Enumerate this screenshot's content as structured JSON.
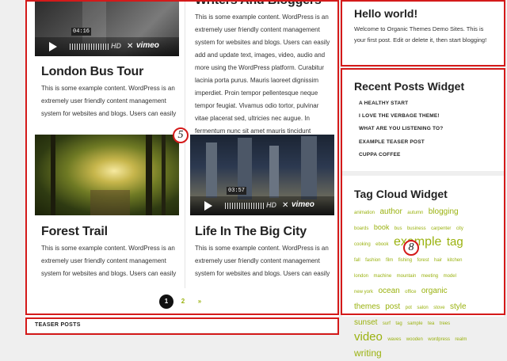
{
  "posts": [
    {
      "title": "London Bus Tour",
      "excerpt": "This is some example content. WordPress is an extremely user friendly content management system for websites and blogs. Users can easily",
      "video": {
        "time": "04:16",
        "hd": "HD",
        "brand": "vimeo"
      }
    },
    {
      "title": "Writers And Bloggers",
      "excerpt": "This is some example content. WordPress is an extremely user friendly content management system for websites and blogs. Users can easily add and update text, images, video, audio and more using the WordPress platform. Curabitur lacinia porta purus. Mauris laoreet dignissim imperdiet. Proin tempor pellentesque neque tempor feugiat. Vivamus odio tortor, pulvinar vitae placerat sed, ultricies nec augue. In fermentum nunc sit amet mauris tincidunt laoreet. Nulla"
    },
    {
      "title": "Forest Trail",
      "excerpt": "This is some example content. WordPress is an extremely user friendly content management system for websites and blogs. Users can easily"
    },
    {
      "title": "Life In The Big City",
      "excerpt": "This is some example content. WordPress is an extremely user friendly content management system for websites and blogs. Users can easily",
      "video": {
        "time": "03:57",
        "hd": "HD",
        "brand": "vimeo"
      }
    }
  ],
  "pagination": {
    "current": "1",
    "next": "2",
    "arrow": "»"
  },
  "teaser": {
    "heading": "TEASER POSTS"
  },
  "markers": {
    "five": "5",
    "eight": "8"
  },
  "sidebar": {
    "hello": {
      "title": "Hello world!",
      "text": "Welcome to Organic Themes Demo Sites. This is your first post. Edit or delete it, then start blogging!"
    },
    "recent": {
      "title": "Recent Posts Widget",
      "items": [
        "A HEALTHY START",
        "I LOVE THE VERBAGE THEME!",
        "WHAT ARE YOU LISTENING TO?",
        "EXAMPLE TEASER POST",
        "CUPPA COFFEE"
      ]
    },
    "tagcloud": {
      "title": "Tag Cloud Widget",
      "tags": [
        {
          "t": "animation",
          "s": 6
        },
        {
          "t": "author",
          "s": 10
        },
        {
          "t": "autumn",
          "s": 6
        },
        {
          "t": "blogging",
          "s": 10
        },
        {
          "t": "boards",
          "s": 6
        },
        {
          "t": "book",
          "s": 9
        },
        {
          "t": "bus",
          "s": 6
        },
        {
          "t": "business",
          "s": 6
        },
        {
          "t": "carpenter",
          "s": 6
        },
        {
          "t": "city",
          "s": 6
        },
        {
          "t": "cooking",
          "s": 6
        },
        {
          "t": "ebook",
          "s": 6
        },
        {
          "t": "example",
          "s": 16
        },
        {
          "t": "tag",
          "s": 15
        },
        {
          "t": "fall",
          "s": 6
        },
        {
          "t": "fashion",
          "s": 6
        },
        {
          "t": "film",
          "s": 6
        },
        {
          "t": "fishing",
          "s": 6
        },
        {
          "t": "forest",
          "s": 6
        },
        {
          "t": "hair",
          "s": 6
        },
        {
          "t": "kitchen",
          "s": 6
        },
        {
          "t": "london",
          "s": 6
        },
        {
          "t": "machine",
          "s": 6
        },
        {
          "t": "mountain",
          "s": 6
        },
        {
          "t": "meeting",
          "s": 6
        },
        {
          "t": "model",
          "s": 6
        },
        {
          "t": "new york",
          "s": 6
        },
        {
          "t": "ocean",
          "s": 10
        },
        {
          "t": "office",
          "s": 6
        },
        {
          "t": "organic",
          "s": 10
        },
        {
          "t": "themes",
          "s": 10
        },
        {
          "t": "post",
          "s": 10
        },
        {
          "t": "pot",
          "s": 6
        },
        {
          "t": "salon",
          "s": 6
        },
        {
          "t": "stove",
          "s": 6
        },
        {
          "t": "style",
          "s": 10
        },
        {
          "t": "sunset",
          "s": 10
        },
        {
          "t": "surf",
          "s": 6
        },
        {
          "t": "tag",
          "s": 6
        },
        {
          "t": "sample",
          "s": 6
        },
        {
          "t": "tea",
          "s": 6
        },
        {
          "t": "trees",
          "s": 6
        },
        {
          "t": "video",
          "s": 15
        },
        {
          "t": "waves",
          "s": 6
        },
        {
          "t": "wooden",
          "s": 6
        },
        {
          "t": "wordpress",
          "s": 6
        },
        {
          "t": "realm",
          "s": 6
        },
        {
          "t": "writing",
          "s": 12
        }
      ]
    }
  },
  "colors": {
    "accent": "#d41a1a",
    "tag": "#9ab20f"
  }
}
